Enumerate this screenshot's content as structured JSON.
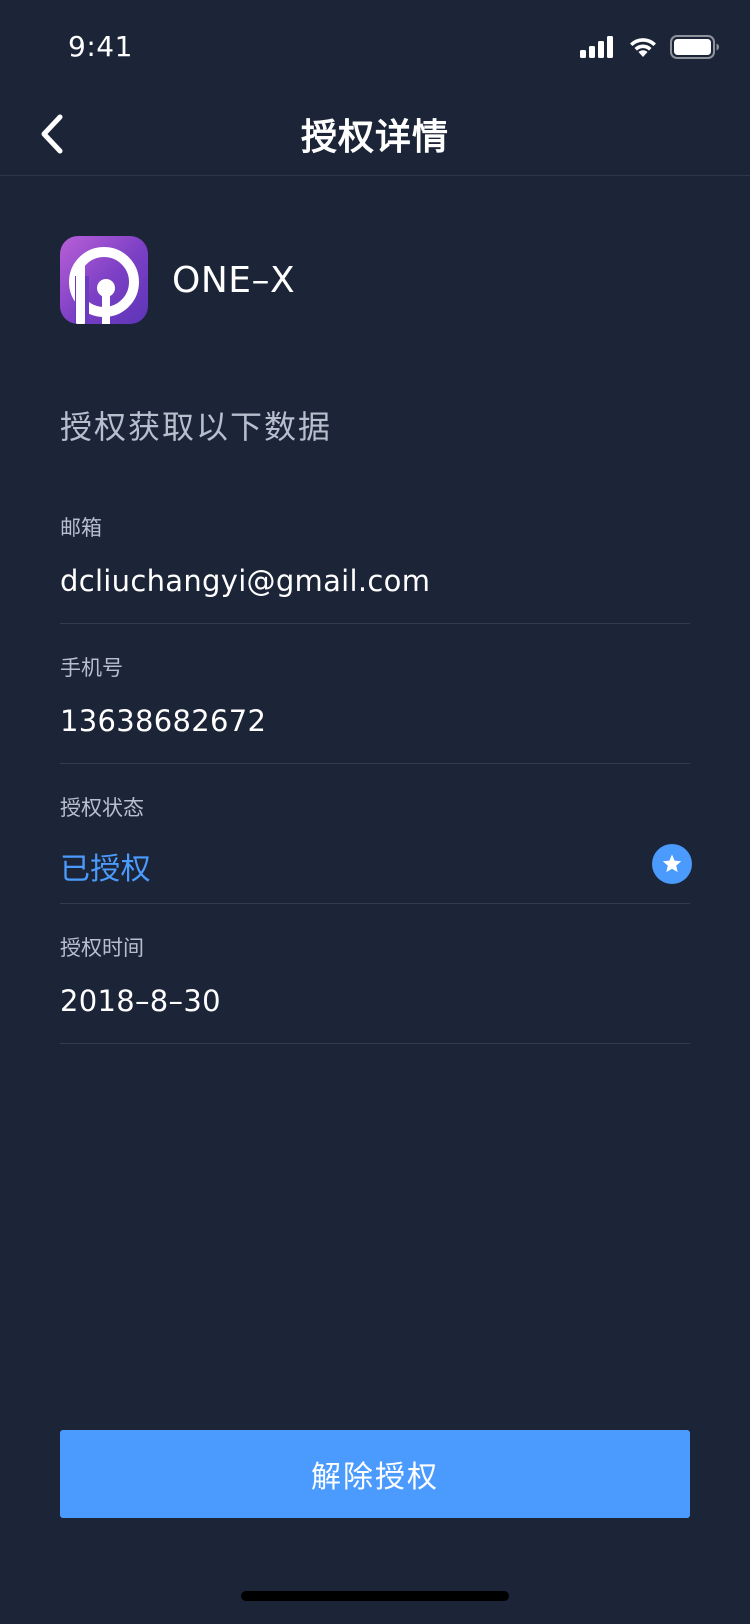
{
  "status_bar": {
    "time": "9:41",
    "icons": [
      "signal-icon",
      "wifi-icon",
      "battery-icon"
    ]
  },
  "nav": {
    "title": "授权详情",
    "back_icon": "chevron-left-icon"
  },
  "app": {
    "name": "ONE–X",
    "icon": "app-logo-icon"
  },
  "section_title": "授权获取以下数据",
  "fields": [
    {
      "label": "邮箱",
      "value": "dcliuchangyi@gmail.com"
    },
    {
      "label": "手机号",
      "value": "13638682672"
    },
    {
      "label": "授权状态",
      "value": "已授权",
      "status_icon": "star-badge-icon"
    },
    {
      "label": "授权时间",
      "value": "2018–8–30"
    }
  ],
  "revoke_button": {
    "label": "解除授权"
  },
  "colors": {
    "background": "#1c2437",
    "accent": "#4b9bff",
    "label": "#b7bfce",
    "divider": "#323b50"
  }
}
